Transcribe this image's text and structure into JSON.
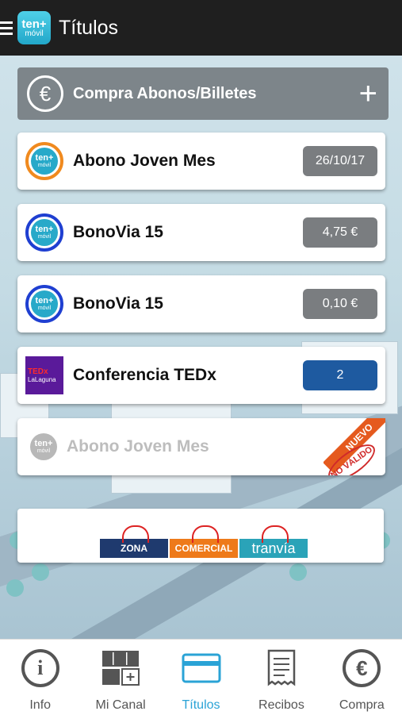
{
  "header": {
    "logo_line1": "ten+",
    "logo_line2": "móvil",
    "title": "Títulos"
  },
  "buy_button": {
    "icon": "euro-icon",
    "label": "Compra Abonos/Billetes",
    "action_icon": "plus-icon",
    "plus": "+",
    "euro": "€"
  },
  "tickets": [
    {
      "name": "Abono Joven Mes",
      "value": "26/10/17",
      "icon": "tenmas-logo-orange"
    },
    {
      "name": "BonoVia 15",
      "value": "4,75 €",
      "icon": "tenmas-logo-blue"
    },
    {
      "name": "BonoVia 15",
      "value": "0,10 €",
      "icon": "tenmas-logo-blue"
    },
    {
      "name": "Conferencia TEDx",
      "value": "2",
      "icon": "tedx-lalaguna-logo"
    },
    {
      "name": "Abono Joven Mes",
      "value": "",
      "icon": "tenmas-logo-grey",
      "ribbon": "NUEVO",
      "stamp": "NO VÁLIDO"
    }
  ],
  "tedx": {
    "line1": "TEDx",
    "line2": "LaLaguna"
  },
  "promo": {
    "bags": [
      "ZONA",
      "COMERCIAL",
      "tranvía"
    ],
    "colors": [
      "#1f3a6e",
      "#ee7a1a",
      "#2aa3b8"
    ]
  },
  "bottom_nav": [
    {
      "label": "Info",
      "icon": "info-icon"
    },
    {
      "label": "Mi Canal",
      "icon": "grid-icon"
    },
    {
      "label": "Títulos",
      "icon": "card-icon",
      "active": true
    },
    {
      "label": "Recibos",
      "icon": "receipt-icon"
    },
    {
      "label": "Compra",
      "icon": "euro-icon"
    }
  ],
  "colors": {
    "accent": "#2aa3d6",
    "topbar": "#1f1f1f",
    "badge_grey": "#7a7d80",
    "badge_blue": "#1e5aa0"
  }
}
